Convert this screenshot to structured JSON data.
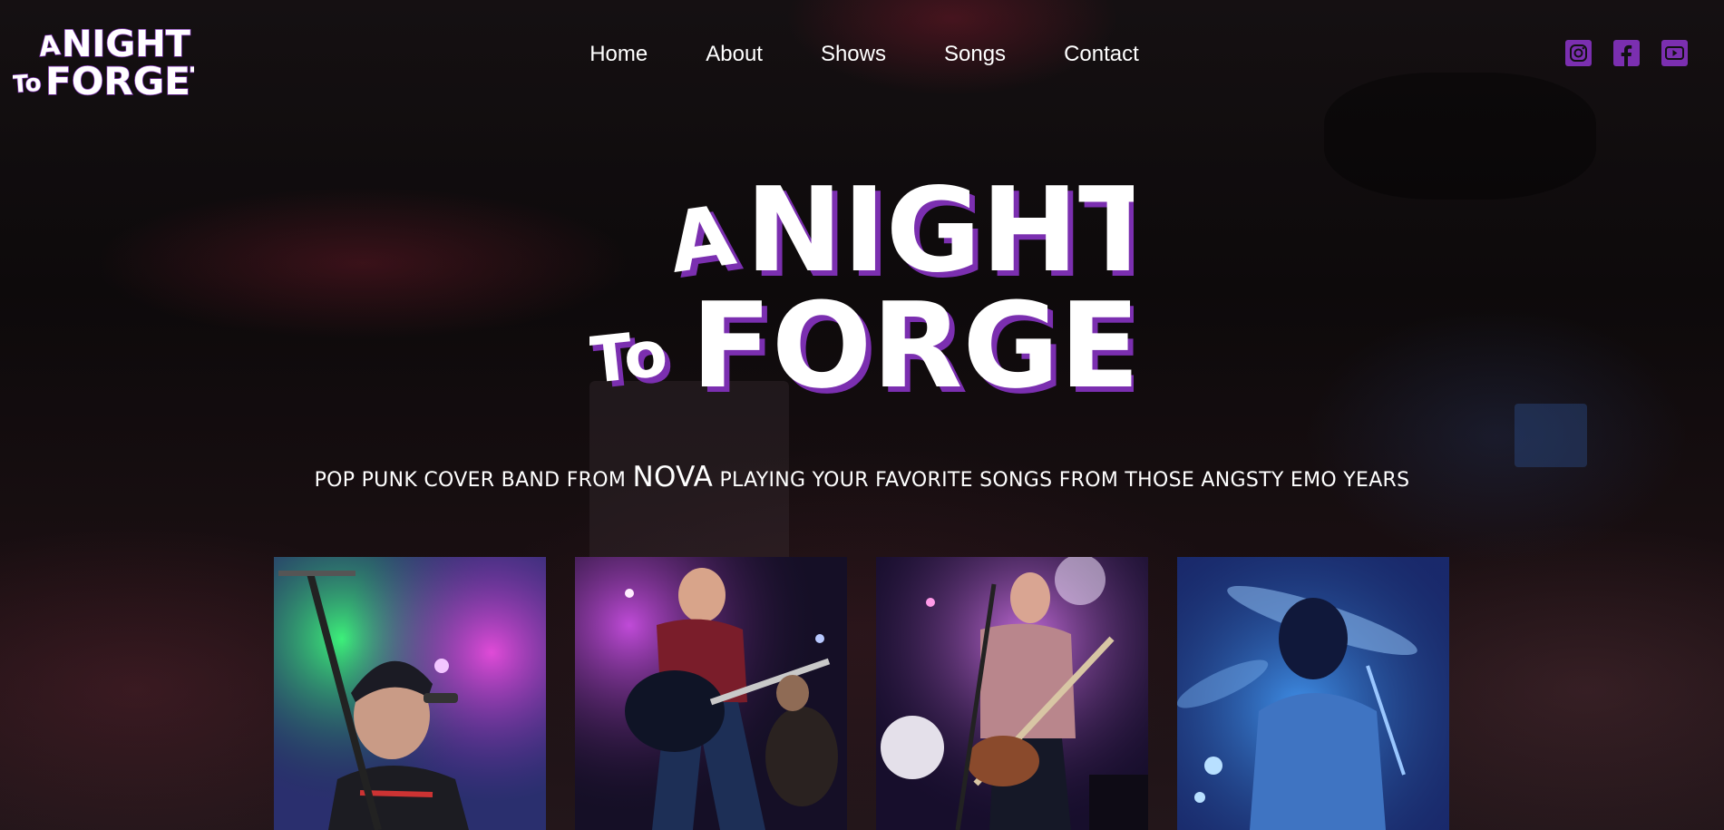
{
  "brand": {
    "logo_line1_a": "A",
    "logo_line1_b": "NIGHT",
    "logo_line2_a": "To",
    "logo_line2_b": "FORGET",
    "accent": "#7b2fb0",
    "logo_fill": "#ffffff"
  },
  "nav": {
    "items": [
      {
        "label": "Home"
      },
      {
        "label": "About"
      },
      {
        "label": "Shows"
      },
      {
        "label": "Songs"
      },
      {
        "label": "Contact"
      }
    ]
  },
  "social": {
    "items": [
      {
        "icon": "instagram-icon"
      },
      {
        "icon": "facebook-icon"
      },
      {
        "icon": "youtube-icon"
      }
    ]
  },
  "hero": {
    "tagline_before": "Pop punk cover band from",
    "tagline_highlight": "NOVA",
    "tagline_after": "playing your favorite songs from those angsty emo years"
  },
  "gallery": {
    "photos": [
      {
        "subject": "vocalist-at-microphone"
      },
      {
        "subject": "guitarist-playing"
      },
      {
        "subject": "bassist-singing"
      },
      {
        "subject": "drummer-with-cymbals"
      }
    ]
  }
}
